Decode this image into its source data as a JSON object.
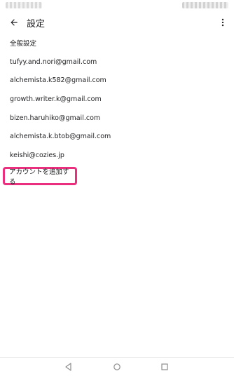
{
  "header": {
    "title": "設定",
    "back_icon": "arrow-left-icon",
    "more_icon": "more-vert-icon"
  },
  "items": [
    {
      "label": "全般設定"
    },
    {
      "label": "tufyy.and.nori@gmail.com"
    },
    {
      "label": "alchemista.k582@gmail.com"
    },
    {
      "label": "growth.writer.k@gmail.com"
    },
    {
      "label": "bizen.haruhiko@gmail.com"
    },
    {
      "label": "alchemista.k.btob@gmail.com"
    },
    {
      "label": "keishi@cozies.jp"
    }
  ],
  "add_account": {
    "label": "アカウントを追加する",
    "highlight_color": "#ea2f7e"
  },
  "nav": {
    "back_icon": "nav-back-triangle-icon",
    "home_icon": "nav-home-circle-icon",
    "recent_icon": "nav-recent-square-icon"
  }
}
